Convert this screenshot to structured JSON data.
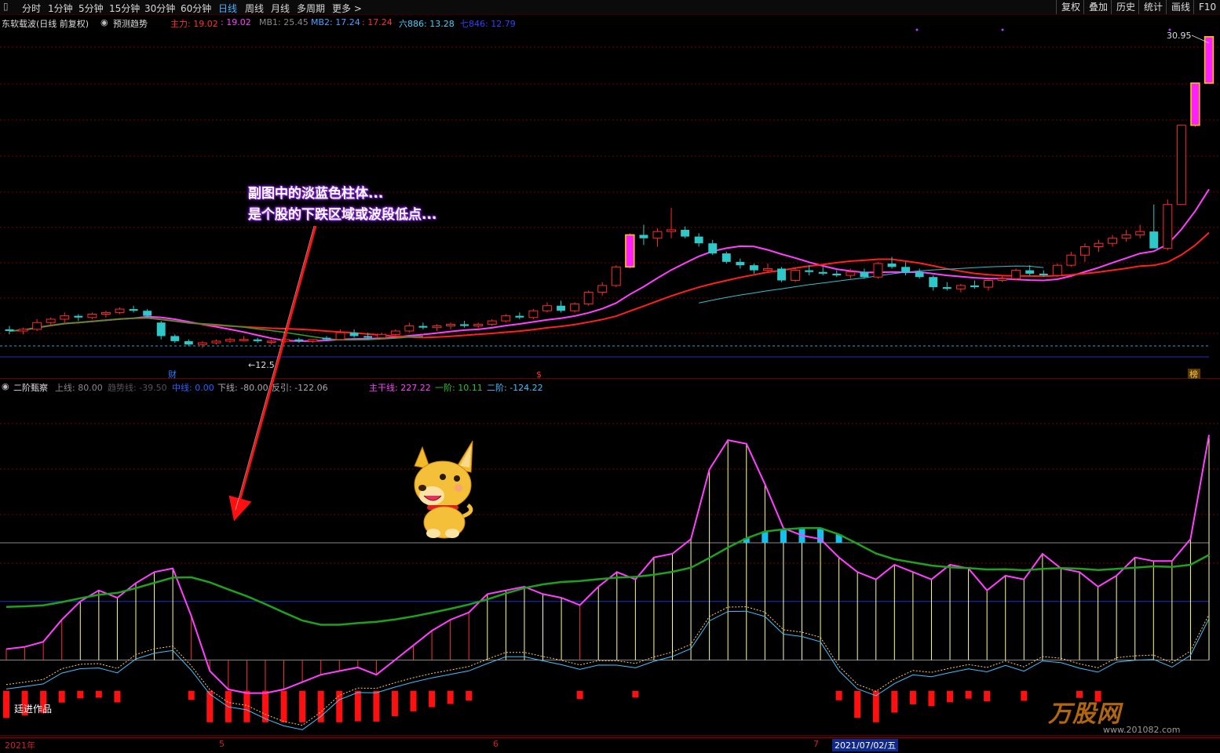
{
  "topbar": {
    "periods": [
      "分时",
      "1分钟",
      "5分钟",
      "15分钟",
      "30分钟",
      "60分钟",
      "日线",
      "周线",
      "月线",
      "多周期",
      "更多 >"
    ],
    "active_period": "日线",
    "right_buttons": [
      "复权",
      "叠加",
      "历史",
      "统计",
      "画线",
      "F10"
    ]
  },
  "main_legend": {
    "stock": "东软载波(日线 前复权)",
    "predict": "预测趋势",
    "items": [
      {
        "text": "主力: 19.02",
        "color": "#ff3030"
      },
      {
        "text": ": 19.02",
        "color": "#ff40ff"
      },
      {
        "text": "MB1: 25.45",
        "color": "#888888"
      },
      {
        "text": "MB2: 17.24",
        "color": "#4aa0ff"
      },
      {
        "text": ": 17.24",
        "color": "#ff3030"
      },
      {
        "text": "六886: 13.28",
        "color": "#40d0ff"
      },
      {
        "text": "七846: 12.79",
        "color": "#3040ff"
      }
    ],
    "high_label": "30.95",
    "low_label": "←12.5",
    "markers": [
      "财",
      "$",
      "榜"
    ]
  },
  "sub_legend": {
    "title": "二阶甄察",
    "items": [
      {
        "text": "上线: 80.00",
        "color": "#888888"
      },
      {
        "text": "趋势线: -39.50",
        "color": "#555555"
      },
      {
        "text": "中线: 0.00",
        "color": "#3060ff"
      },
      {
        "text": "下线: -80.00",
        "color": "#aaaaaa"
      },
      {
        "text": "反引: -122.06",
        "color": "#aaaaaa"
      },
      {
        "text": "主干线: 227.22",
        "color": "#ff40ff"
      },
      {
        "text": "一阶: 10.11",
        "color": "#30c030"
      },
      {
        "text": "二阶: -124.22",
        "color": "#40c0ff"
      }
    ]
  },
  "annotation": {
    "line1": "副图中的淡蓝色柱体...",
    "line2": "是个股的下跌区域或波段低点..."
  },
  "credit": "廷进作品",
  "date_axis": {
    "ticks": [
      "2021年",
      "5",
      "6",
      "7"
    ],
    "cursor_date": "2021/07/02/五"
  },
  "watermark": {
    "brand": "万股网",
    "url": "www.201082.com"
  },
  "chart_data": [
    {
      "type": "candlestick",
      "title": "东软载波(日线 前复权)",
      "ylim": [
        11.5,
        31.5
      ],
      "high": 30.95,
      "low": 12.5,
      "candles": [
        [
          13.6,
          13.8,
          13.3,
          13.5
        ],
        [
          13.5,
          13.7,
          13.3,
          13.6
        ],
        [
          13.6,
          14.2,
          13.5,
          14.0
        ],
        [
          14.0,
          14.3,
          13.8,
          14.2
        ],
        [
          14.2,
          14.6,
          14.0,
          14.4
        ],
        [
          14.4,
          14.5,
          14.1,
          14.3
        ],
        [
          14.3,
          14.6,
          14.2,
          14.5
        ],
        [
          14.5,
          14.7,
          14.3,
          14.6
        ],
        [
          14.6,
          14.9,
          14.5,
          14.8
        ],
        [
          14.8,
          15.0,
          14.6,
          14.7
        ],
        [
          14.7,
          14.8,
          14.3,
          14.4
        ],
        [
          14.0,
          14.1,
          13.0,
          13.2
        ],
        [
          13.2,
          13.3,
          12.8,
          12.9
        ],
        [
          12.9,
          13.0,
          12.6,
          12.7
        ],
        [
          12.7,
          12.9,
          12.5,
          12.8
        ],
        [
          12.8,
          13.0,
          12.7,
          12.9
        ],
        [
          12.9,
          13.1,
          12.8,
          13.0
        ],
        [
          13.0,
          13.2,
          12.9,
          13.0
        ],
        [
          13.0,
          13.1,
          12.8,
          12.9
        ],
        [
          12.9,
          13.0,
          12.7,
          12.9
        ],
        [
          12.9,
          13.1,
          12.8,
          13.0
        ],
        [
          13.0,
          13.1,
          12.8,
          12.9
        ],
        [
          12.9,
          13.0,
          12.8,
          13.0
        ],
        [
          13.1,
          13.2,
          12.9,
          13.0
        ],
        [
          13.0,
          13.6,
          13.0,
          13.4
        ],
        [
          13.4,
          13.6,
          13.1,
          13.2
        ],
        [
          13.2,
          13.4,
          13.0,
          13.1
        ],
        [
          13.1,
          13.4,
          13.0,
          13.3
        ],
        [
          13.3,
          13.6,
          13.2,
          13.5
        ],
        [
          13.5,
          14.0,
          13.4,
          13.8
        ],
        [
          13.8,
          14.0,
          13.6,
          13.7
        ],
        [
          13.7,
          13.9,
          13.5,
          13.8
        ],
        [
          13.8,
          14.0,
          13.6,
          13.9
        ],
        [
          13.9,
          14.1,
          13.7,
          13.8
        ],
        [
          13.8,
          14.0,
          13.6,
          13.9
        ],
        [
          13.9,
          14.2,
          13.8,
          14.1
        ],
        [
          14.1,
          14.5,
          14.0,
          14.4
        ],
        [
          14.4,
          14.6,
          14.2,
          14.3
        ],
        [
          14.3,
          14.8,
          14.2,
          14.7
        ],
        [
          14.7,
          15.2,
          14.6,
          15.0
        ],
        [
          15.0,
          15.3,
          14.6,
          14.7
        ],
        [
          14.7,
          15.2,
          14.6,
          15.1
        ],
        [
          15.1,
          15.9,
          15.0,
          15.8
        ],
        [
          15.8,
          16.4,
          15.6,
          16.2
        ],
        [
          16.2,
          17.4,
          16.1,
          17.3
        ],
        [
          17.3,
          19.3,
          17.2,
          19.2
        ],
        [
          19.2,
          19.8,
          18.6,
          19.0
        ],
        [
          19.0,
          19.6,
          18.5,
          19.4
        ],
        [
          19.4,
          20.8,
          19.0,
          19.5
        ],
        [
          19.5,
          19.7,
          19.0,
          19.1
        ],
        [
          19.1,
          19.3,
          18.5,
          18.7
        ],
        [
          18.7,
          18.9,
          18.0,
          18.1
        ],
        [
          18.1,
          18.2,
          17.5,
          17.6
        ],
        [
          17.6,
          17.8,
          17.2,
          17.4
        ],
        [
          17.4,
          17.5,
          16.9,
          17.1
        ],
        [
          17.1,
          17.5,
          17.0,
          17.2
        ],
        [
          17.2,
          17.3,
          16.4,
          16.5
        ],
        [
          16.5,
          17.2,
          16.4,
          17.1
        ],
        [
          17.1,
          17.4,
          16.8,
          17.0
        ],
        [
          17.0,
          17.3,
          16.8,
          16.9
        ],
        [
          16.9,
          17.1,
          16.7,
          16.8
        ],
        [
          16.8,
          17.2,
          16.6,
          17.0
        ],
        [
          17.0,
          17.2,
          16.6,
          16.7
        ],
        [
          16.7,
          17.6,
          16.6,
          17.5
        ],
        [
          17.5,
          17.9,
          17.2,
          17.3
        ],
        [
          17.3,
          17.6,
          16.8,
          17.0
        ],
        [
          17.0,
          17.2,
          16.6,
          16.7
        ],
        [
          16.7,
          16.8,
          15.9,
          16.1
        ],
        [
          16.1,
          16.4,
          15.9,
          16.0
        ],
        [
          16.0,
          16.3,
          15.8,
          16.2
        ],
        [
          16.2,
          16.5,
          16.0,
          16.1
        ],
        [
          16.1,
          16.6,
          15.9,
          16.5
        ],
        [
          16.5,
          16.8,
          16.4,
          16.6
        ],
        [
          16.6,
          17.2,
          16.5,
          17.1
        ],
        [
          17.1,
          17.4,
          16.8,
          16.9
        ],
        [
          16.9,
          17.1,
          16.7,
          16.8
        ],
        [
          16.8,
          17.5,
          16.7,
          17.4
        ],
        [
          17.4,
          18.2,
          17.3,
          18.0
        ],
        [
          18.0,
          18.7,
          17.6,
          18.5
        ],
        [
          18.5,
          18.9,
          18.2,
          18.7
        ],
        [
          18.7,
          19.2,
          18.5,
          19.0
        ],
        [
          19.0,
          19.5,
          18.8,
          19.2
        ],
        [
          19.2,
          19.8,
          19.0,
          19.4
        ],
        [
          19.4,
          21.0,
          19.2,
          18.4
        ],
        [
          18.4,
          21.3,
          18.3,
          21.0
        ],
        [
          21.0,
          25.7,
          21.0,
          25.7
        ],
        [
          25.7,
          28.2,
          25.6,
          28.2
        ],
        [
          28.2,
          30.95,
          28.2,
          30.95
        ]
      ],
      "ma_series": [
        {
          "name": "MB2",
          "color": "#ff40ff"
        },
        {
          "name": "主力",
          "color": "#ff2020"
        },
        {
          "name": "六886",
          "color": "#30c0d0"
        },
        {
          "name": "七846",
          "color": "#3040ff"
        }
      ]
    },
    {
      "type": "line",
      "title": "二阶甄察",
      "ylim": [
        -180,
        280
      ],
      "upper": 80,
      "middle": 0,
      "lower": -80,
      "main_trunk": [
        -65,
        -62,
        -55,
        -25,
        0,
        15,
        5,
        25,
        40,
        45,
        -20,
        -95,
        -120,
        -125,
        -125,
        -120,
        -110,
        -100,
        -95,
        -90,
        -100,
        -80,
        -60,
        -40,
        -25,
        -15,
        10,
        15,
        20,
        10,
        5,
        -5,
        20,
        40,
        30,
        60,
        65,
        85,
        180,
        220,
        215,
        160,
        100,
        90,
        85,
        60,
        40,
        30,
        50,
        40,
        30,
        50,
        45,
        15,
        35,
        30,
        65,
        45,
        40,
        20,
        35,
        60,
        55,
        55,
        85,
        227
      ]
    }
  ]
}
